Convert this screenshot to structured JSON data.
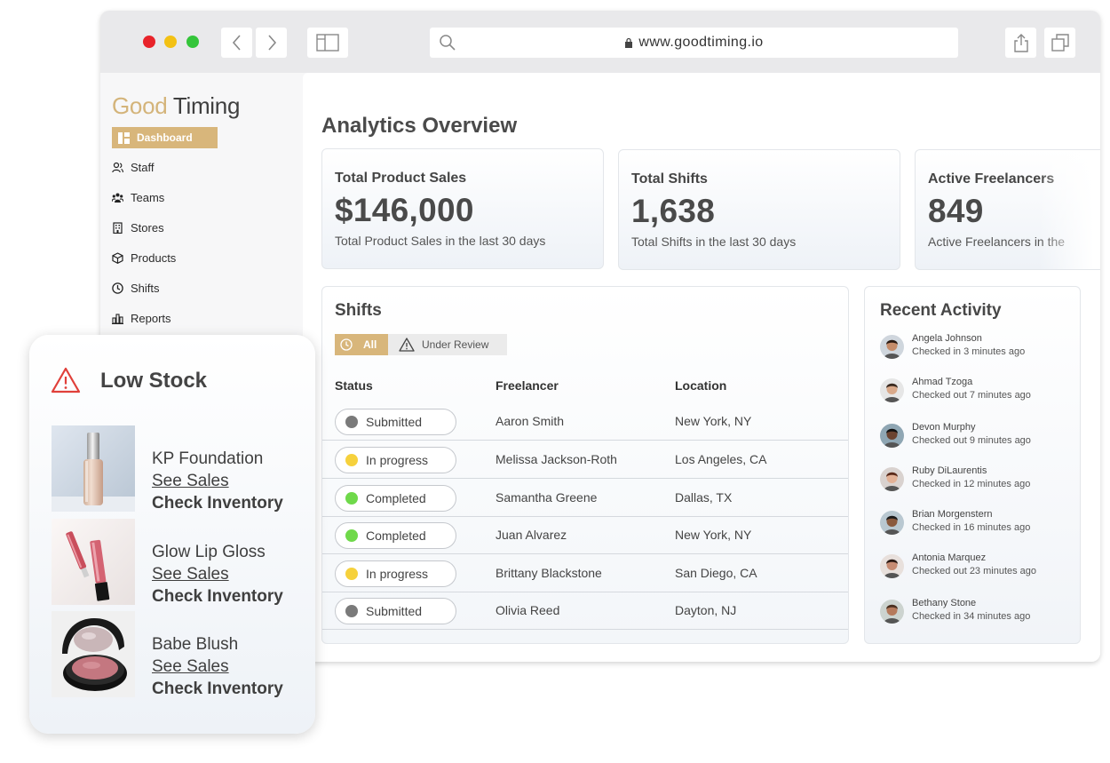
{
  "browser": {
    "url": "www.goodtiming.io"
  },
  "brand": {
    "logo_part1": "Good",
    "logo_part2": " Timing",
    "accent": "#d8b67b"
  },
  "sidebar": {
    "items": [
      {
        "label": "Dashboard",
        "icon": "dashboard-icon",
        "active": true
      },
      {
        "label": "Staff",
        "icon": "users-icon"
      },
      {
        "label": "Teams",
        "icon": "teams-icon"
      },
      {
        "label": "Stores",
        "icon": "building-icon"
      },
      {
        "label": "Products",
        "icon": "box-icon"
      },
      {
        "label": "Shifts",
        "icon": "clock-icon"
      },
      {
        "label": "Reports",
        "icon": "bar-chart-icon"
      }
    ]
  },
  "main": {
    "title": "Analytics Overview",
    "stats": [
      {
        "label": "Total Product Sales",
        "value": "$146,000",
        "desc": "Total Product Sales in the last 30 days"
      },
      {
        "label": "Total Shifts",
        "value": "1,638",
        "desc": "Total Shifts in the last 30 days"
      },
      {
        "label": "Active Freelancers",
        "value": "849",
        "desc": "Active Freelancers in the"
      }
    ]
  },
  "shifts": {
    "title": "Shifts",
    "filters": {
      "all": "All",
      "review": "Under Review"
    },
    "headers": {
      "status": "Status",
      "freelancer": "Freelancer",
      "location": "Location"
    },
    "rows": [
      {
        "status": "Submitted",
        "color": "#7a7a7a",
        "freelancer": "Aaron Smith",
        "location": "New York, NY"
      },
      {
        "status": "In progress",
        "color": "#f6d13c",
        "freelancer": "Melissa Jackson-Roth",
        "location": "Los Angeles, CA"
      },
      {
        "status": "Completed",
        "color": "#6fd94a",
        "freelancer": "Samantha Greene",
        "location": "Dallas, TX"
      },
      {
        "status": "Completed",
        "color": "#6fd94a",
        "freelancer": "Juan Alvarez",
        "location": "New York, NY"
      },
      {
        "status": "In progress",
        "color": "#f6d13c",
        "freelancer": "Brittany Blackstone",
        "location": "San Diego, CA"
      },
      {
        "status": "Submitted",
        "color": "#7a7a7a",
        "freelancer": "Olivia Reed",
        "location": "Dayton, NJ"
      }
    ]
  },
  "activity": {
    "title": "Recent Activity",
    "items": [
      {
        "name": "Angela Johnson",
        "status": "Checked in 3 minutes ago"
      },
      {
        "name": "Ahmad Tzoga",
        "status": "Checked out 7 minutes ago"
      },
      {
        "name": "Devon Murphy",
        "status": "Checked out 9 minutes ago"
      },
      {
        "name": "Ruby DiLaurentis",
        "status": "Checked in 12 minutes ago"
      },
      {
        "name": "Brian Morgenstern",
        "status": "Checked in 16 minutes ago"
      },
      {
        "name": "Antonia Marquez",
        "status": "Checked out 23 minutes ago"
      },
      {
        "name": "Bethany Stone",
        "status": "Checked in 34 minutes ago"
      }
    ]
  },
  "low_stock": {
    "title": "Low Stock",
    "products": [
      {
        "name": "KP Foundation",
        "sales_link": "See Sales",
        "inventory_link": "Check Inventory"
      },
      {
        "name": "Glow Lip Gloss",
        "sales_link": "See Sales",
        "inventory_link": "Check Inventory"
      },
      {
        "name": "Babe Blush",
        "sales_link": "See Sales",
        "inventory_link": "Check Inventory"
      }
    ]
  }
}
